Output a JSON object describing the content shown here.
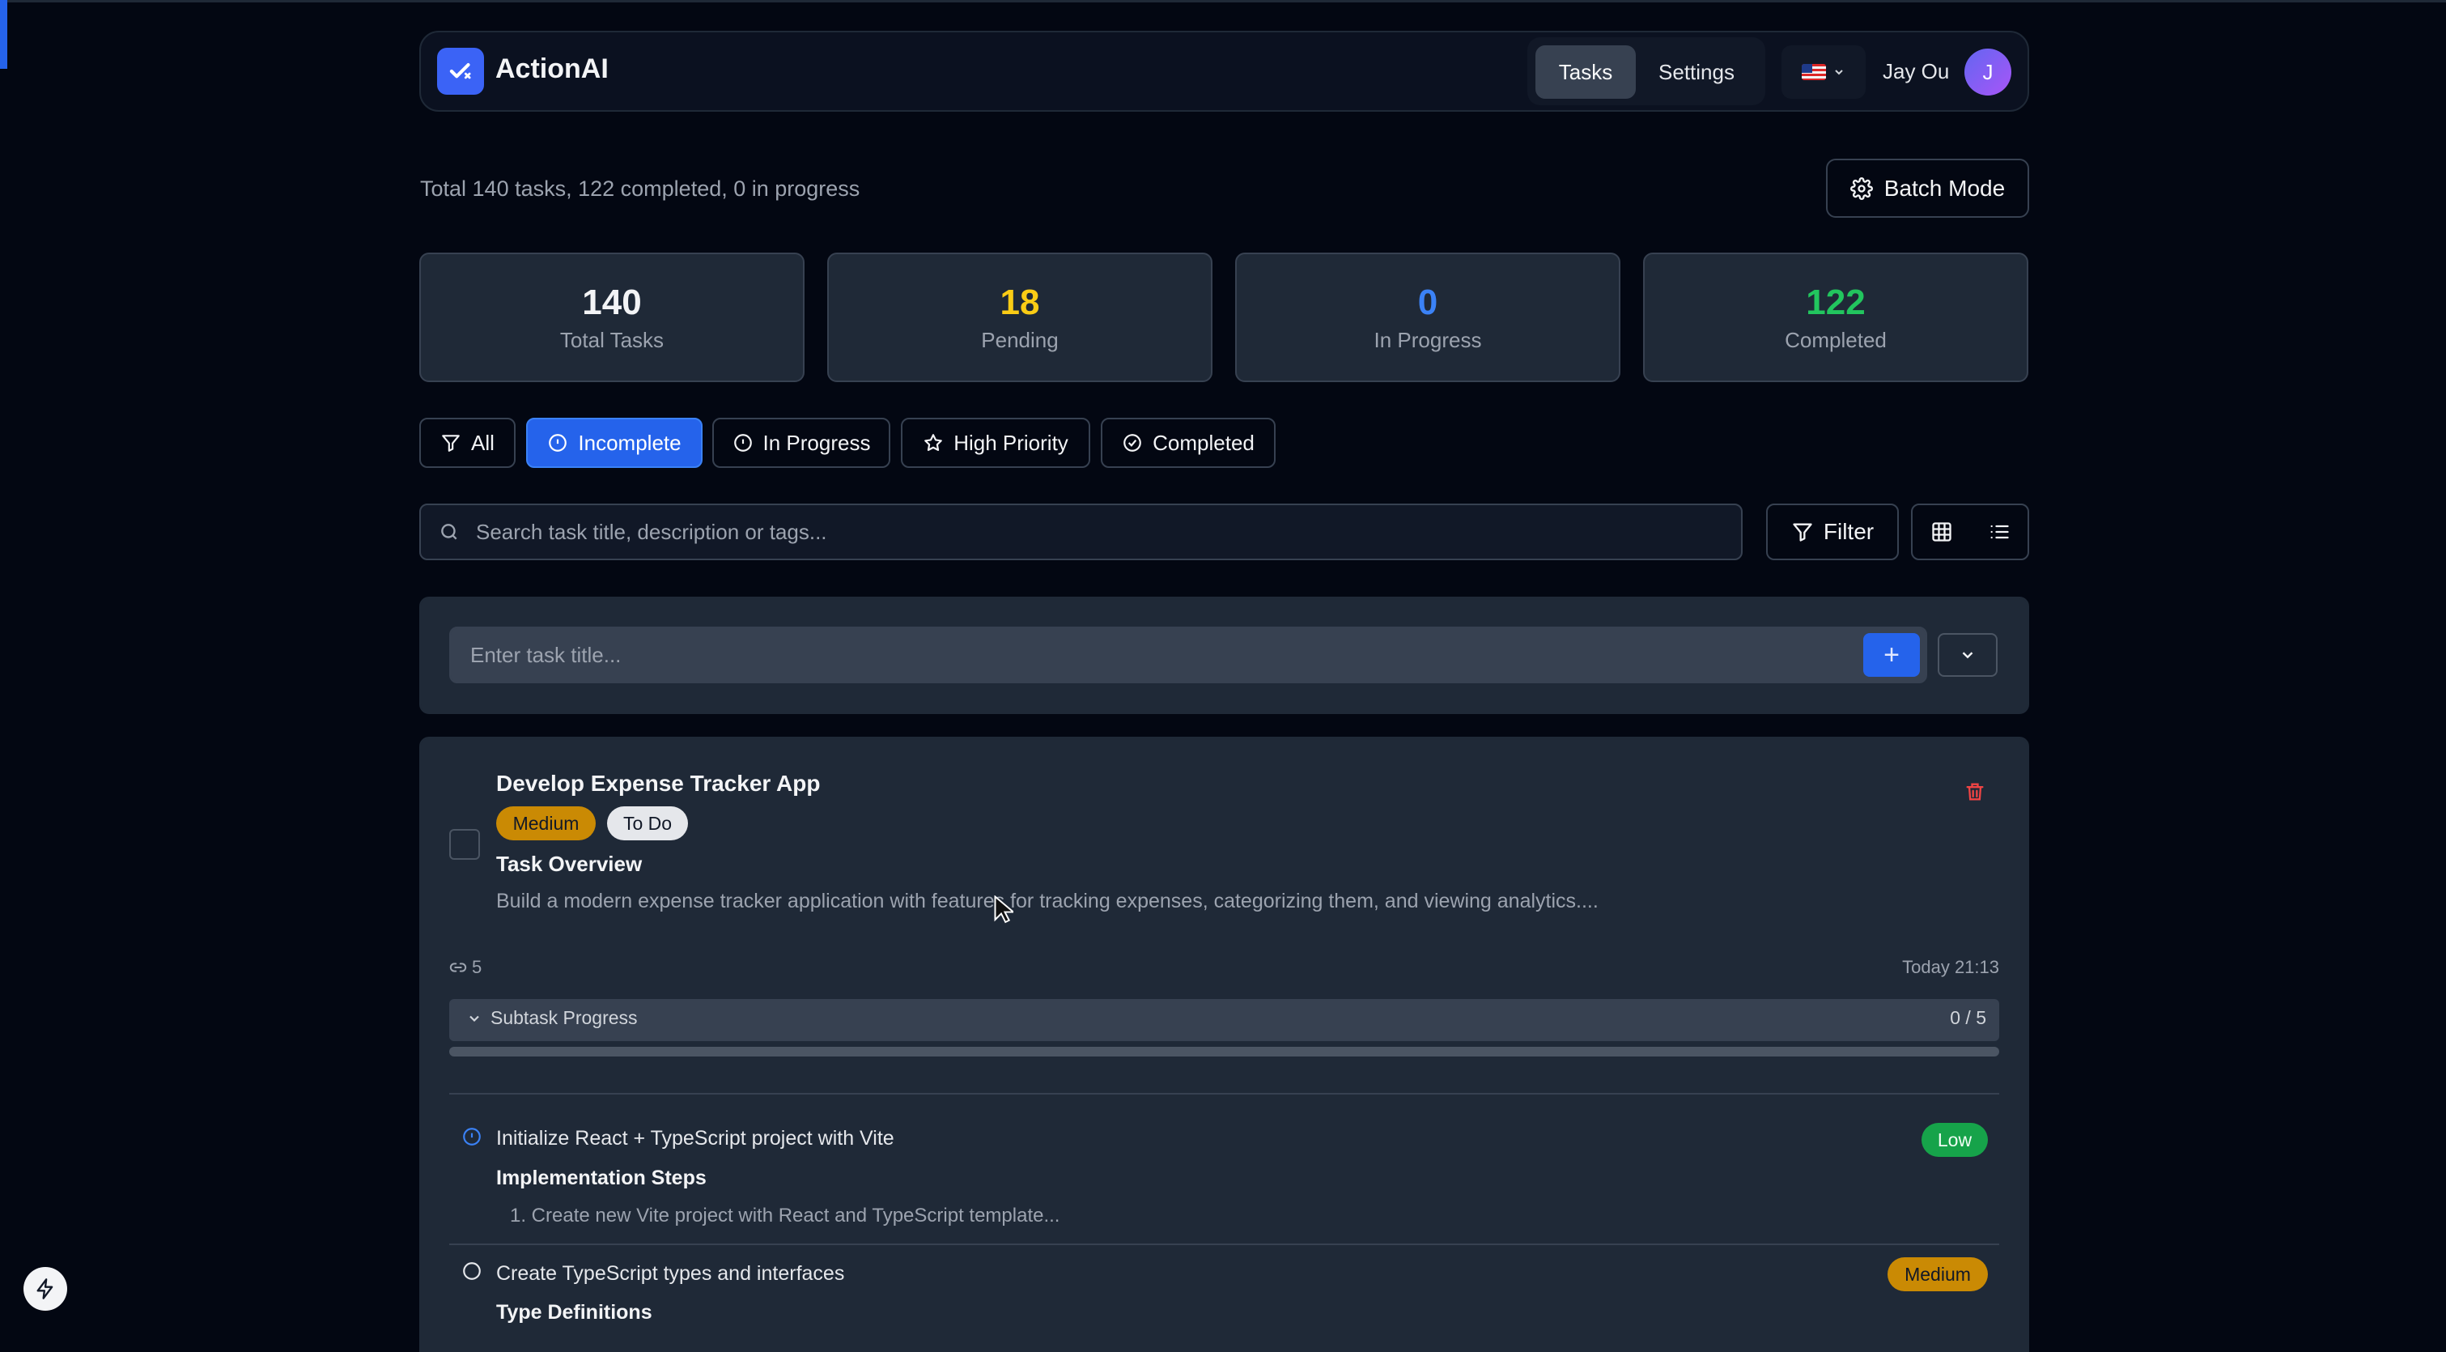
{
  "app": {
    "name": "ActionAI"
  },
  "nav": {
    "tasks": "Tasks",
    "settings": "Settings"
  },
  "user": {
    "name": "Jay Ou",
    "initial": "J"
  },
  "summary": "Total 140 tasks, 122 completed, 0 in progress",
  "batch_mode": "Batch Mode",
  "stats": [
    {
      "value": "140",
      "label": "Total Tasks",
      "color": "#f3f4f6"
    },
    {
      "value": "18",
      "label": "Pending",
      "color": "#facc15"
    },
    {
      "value": "0",
      "label": "In Progress",
      "color": "#3b82f6"
    },
    {
      "value": "122",
      "label": "Completed",
      "color": "#22c55e"
    }
  ],
  "tabs": [
    {
      "label": "All",
      "icon": "filter-icon"
    },
    {
      "label": "Incomplete",
      "icon": "alert-circle-icon",
      "active": true
    },
    {
      "label": "In Progress",
      "icon": "alert-circle-icon"
    },
    {
      "label": "High Priority",
      "icon": "star-icon"
    },
    {
      "label": "Completed",
      "icon": "check-circle-icon"
    }
  ],
  "search": {
    "placeholder": "Search task title, description or tags..."
  },
  "filter_label": "Filter",
  "new_task": {
    "placeholder": "Enter task title...",
    "add_symbol": "+"
  },
  "task": {
    "title": "Develop Expense Tracker App",
    "priority": "Medium",
    "status": "To Do",
    "heading": "Task Overview",
    "description": "Build a modern expense tracker application with features for tracking expenses, categorizing them, and viewing analytics....",
    "link_count": "5",
    "timestamp": "Today 21:13",
    "subtask_label": "Subtask Progress",
    "subtask_count": "0 / 5",
    "subtask_progress": 0,
    "subtasks": [
      {
        "title": "Initialize React + TypeScript project with Vite",
        "heading": "Implementation Steps",
        "step": "1. Create new Vite project with React and TypeScript template...",
        "priority": "Low"
      },
      {
        "title": "Create TypeScript types and interfaces",
        "heading": "Type Definitions",
        "priority": "Medium"
      }
    ]
  }
}
